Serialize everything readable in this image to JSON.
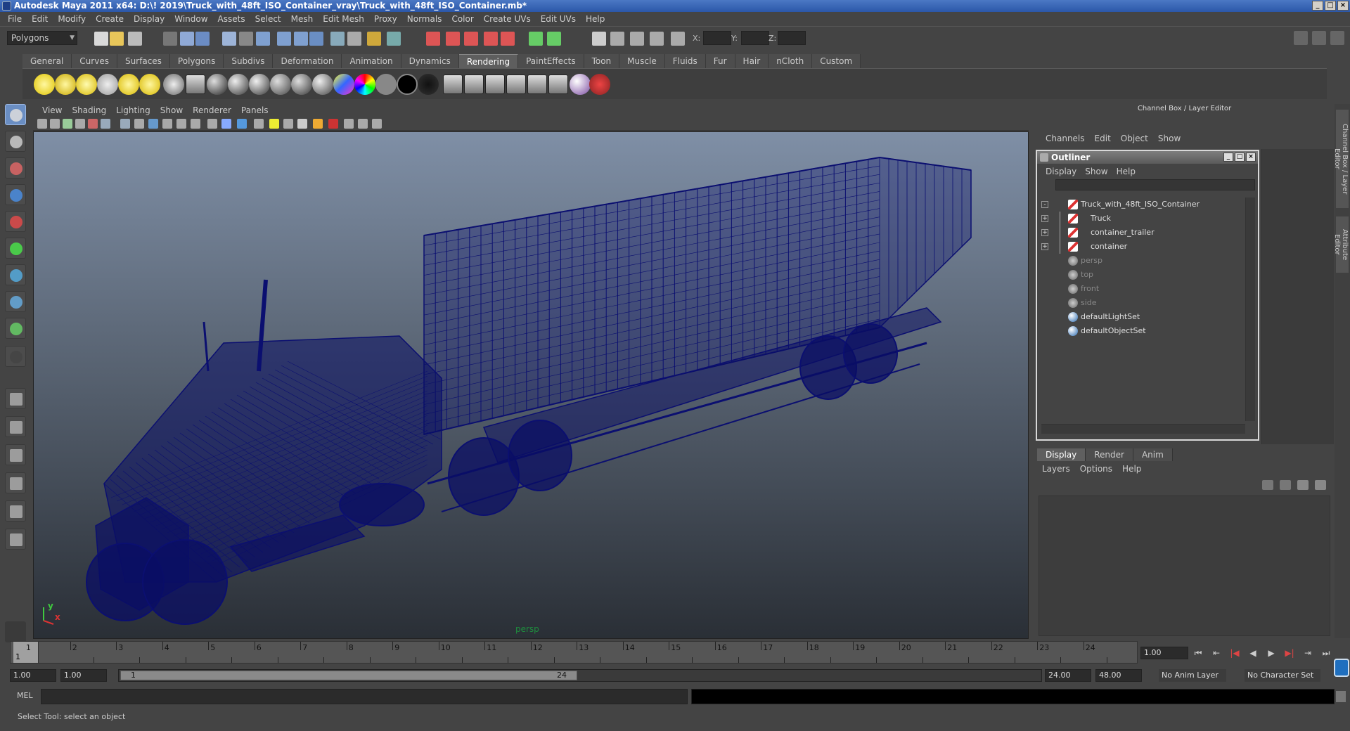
{
  "window": {
    "title": "Autodesk Maya 2011 x64: D:\\! 2019\\Truck_with_48ft_ISO_Container_vray\\Truck_with_48ft_ISO_Container.mb*"
  },
  "menubar": [
    "File",
    "Edit",
    "Modify",
    "Create",
    "Display",
    "Window",
    "Assets",
    "Select",
    "Mesh",
    "Edit Mesh",
    "Proxy",
    "Normals",
    "Color",
    "Create UVs",
    "Edit UVs",
    "Help"
  ],
  "status_line": {
    "mode": "Polygons",
    "x_label": "X:",
    "y_label": "Y:",
    "z_label": "Z:"
  },
  "shelf_tabs": [
    "General",
    "Curves",
    "Surfaces",
    "Polygons",
    "Subdivs",
    "Deformation",
    "Animation",
    "Dynamics",
    "Rendering",
    "PaintEffects",
    "Toon",
    "Muscle",
    "Fluids",
    "Fur",
    "Hair",
    "nCloth",
    "Custom"
  ],
  "active_shelf": "Rendering",
  "viewport": {
    "menu": [
      "View",
      "Shading",
      "Lighting",
      "Show",
      "Renderer",
      "Panels"
    ],
    "camera": "persp",
    "axis_y": "y",
    "axis_x": "x",
    "wire_color": "#0b0f70"
  },
  "channel_box": {
    "header": "Channel Box / Layer Editor",
    "menu": [
      "Channels",
      "Edit",
      "Object",
      "Show"
    ]
  },
  "outliner": {
    "title": "Outliner",
    "menu": [
      "Display",
      "Show",
      "Help"
    ],
    "items": [
      {
        "label": "Truck_with_48ft_ISO_Container",
        "icon": "transform-icon",
        "expand": "-"
      },
      {
        "label": "Truck",
        "icon": "transform-icon",
        "expand": "+"
      },
      {
        "label": "container_trailer",
        "icon": "transform-icon",
        "expand": "+"
      },
      {
        "label": "container",
        "icon": "transform-icon",
        "expand": "+"
      },
      {
        "label": "persp",
        "icon": "camera-icon",
        "expand": ""
      },
      {
        "label": "top",
        "icon": "camera-icon",
        "expand": ""
      },
      {
        "label": "front",
        "icon": "camera-icon",
        "expand": ""
      },
      {
        "label": "side",
        "icon": "camera-icon",
        "expand": ""
      },
      {
        "label": "defaultLightSet",
        "icon": "set-icon",
        "expand": ""
      },
      {
        "label": "defaultObjectSet",
        "icon": "set-icon",
        "expand": ""
      }
    ]
  },
  "layer_editor": {
    "tabs": [
      "Display",
      "Render",
      "Anim"
    ],
    "menu": [
      "Layers",
      "Options",
      "Help"
    ]
  },
  "side_tabs": [
    "Channel Box / Layer Editor",
    "Attribute Editor"
  ],
  "timeline": {
    "ticks": [
      "1",
      "2",
      "3",
      "4",
      "5",
      "6",
      "7",
      "8",
      "9",
      "10",
      "11",
      "12",
      "13",
      "14",
      "15",
      "16",
      "17",
      "18",
      "19",
      "20",
      "21",
      "22",
      "23",
      "24"
    ],
    "current_frame": "1",
    "frame_field": "1.00"
  },
  "range": {
    "start": "1.00",
    "start2": "1.00",
    "handle_start": "1",
    "handle_end": "24",
    "end": "24.00",
    "end2": "48.00",
    "anim_layer": "No Anim Layer",
    "character_set": "No Character Set"
  },
  "command_line": {
    "label": "MEL"
  },
  "help_line": "Select Tool: select an object"
}
